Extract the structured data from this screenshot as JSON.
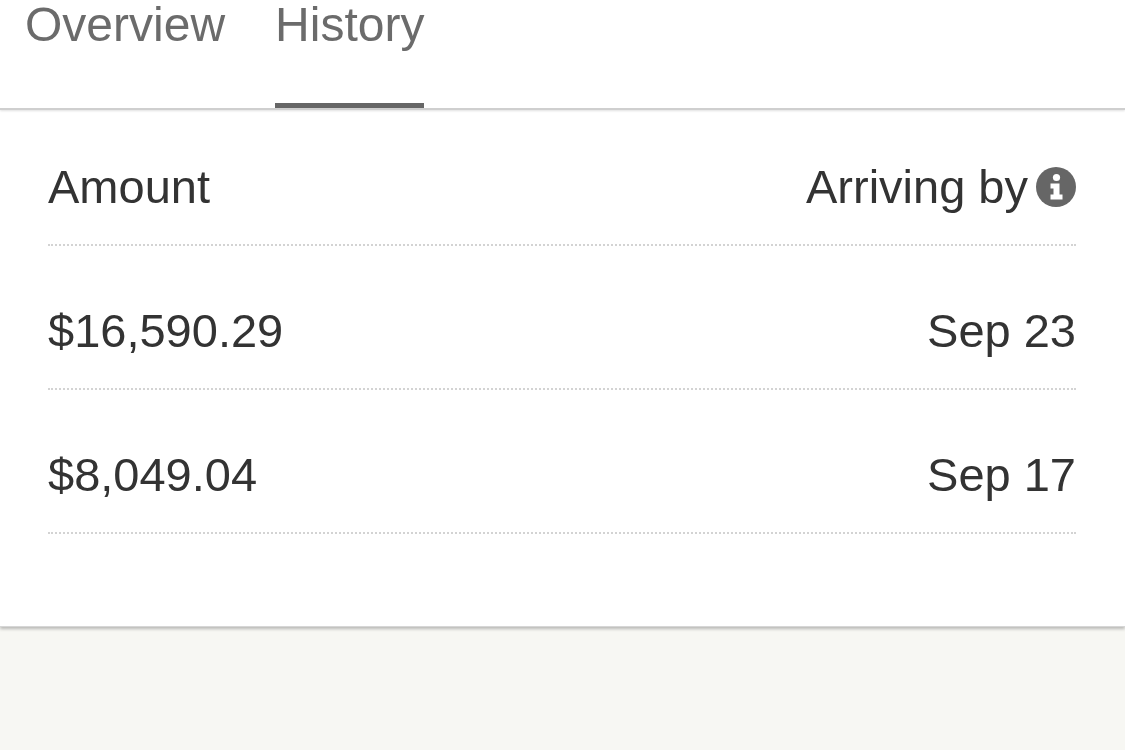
{
  "tabs": [
    {
      "label": "Overview",
      "selected": false
    },
    {
      "label": "History",
      "selected": true
    }
  ],
  "table": {
    "columns": [
      {
        "label": "Amount",
        "info_icon": false
      },
      {
        "label": "Arriving by",
        "info_icon": true
      }
    ],
    "rows": [
      {
        "amount": "$16,590.29",
        "arriving_by": "Sep 23"
      },
      {
        "amount": "$8,049.04",
        "arriving_by": "Sep 17"
      }
    ]
  }
}
